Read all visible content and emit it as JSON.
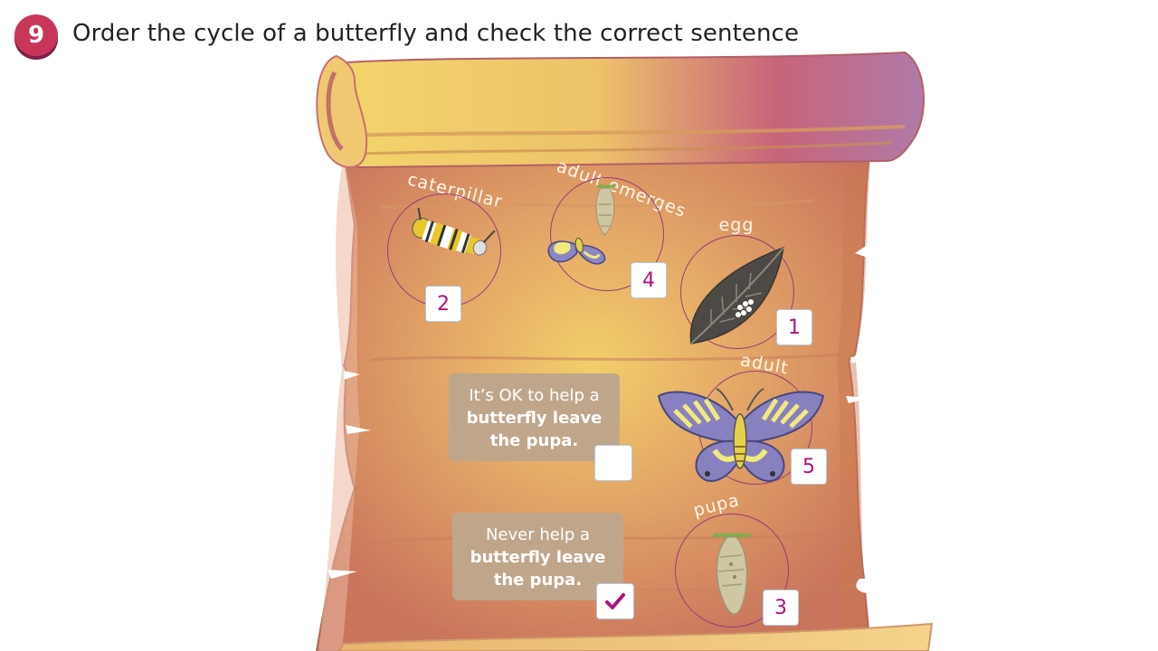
{
  "question": {
    "number": "9",
    "title": "Order the cycle of a butterfly and check the correct sentence"
  },
  "stages": [
    {
      "id": "caterpillar",
      "label": "caterpillar",
      "order": "2"
    },
    {
      "id": "adult-emerges",
      "label": "adult emerges",
      "order": "4"
    },
    {
      "id": "egg",
      "label": "egg",
      "order": "1"
    },
    {
      "id": "adult",
      "label": "adult",
      "order": "5"
    },
    {
      "id": "pupa",
      "label": "pupa",
      "order": "3"
    }
  ],
  "sentences": [
    {
      "light": "It’s OK to help a",
      "bold1": "butterfly leave",
      "bold2": "the pupa.",
      "checked": false
    },
    {
      "light": "Never help a",
      "bold1": "butterfly leave",
      "bold2": "the pupa.",
      "checked": true
    }
  ],
  "colors": {
    "badge": "#c8365a",
    "accent_number": "#b0107a",
    "sentence_bg": "#bfa68b",
    "circle_stroke": "#9a3b7b"
  }
}
